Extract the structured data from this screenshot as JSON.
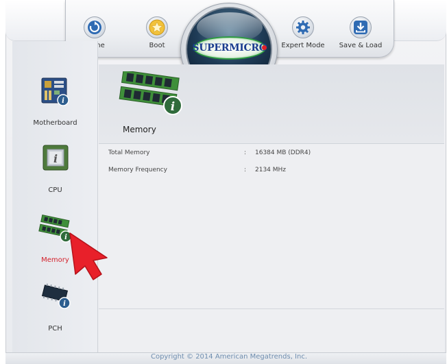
{
  "brand": {
    "logo_text": "SUPERMICRO"
  },
  "nav": {
    "home_label": "Home",
    "boot_label": "Boot",
    "expert_label": "Expert Mode",
    "save_label": "Save & Load"
  },
  "sidebar": {
    "items": [
      {
        "label": "Motherboard",
        "icon": "motherboard-icon"
      },
      {
        "label": "CPU",
        "icon": "cpu-icon"
      },
      {
        "label": "Memory",
        "icon": "memory-icon",
        "active": true
      },
      {
        "label": "PCH",
        "icon": "pch-icon"
      }
    ],
    "active_color": "#d4202a"
  },
  "main": {
    "title": "Memory",
    "rows": [
      {
        "label": "Total Memory",
        "sep": ":",
        "value": "16384 MB (DDR4)"
      },
      {
        "label": "Memory Frequency",
        "sep": ":",
        "value": "2134 MHz"
      }
    ]
  },
  "footer": {
    "copyright": "Copyright © 2014 American Megatrends, Inc."
  }
}
